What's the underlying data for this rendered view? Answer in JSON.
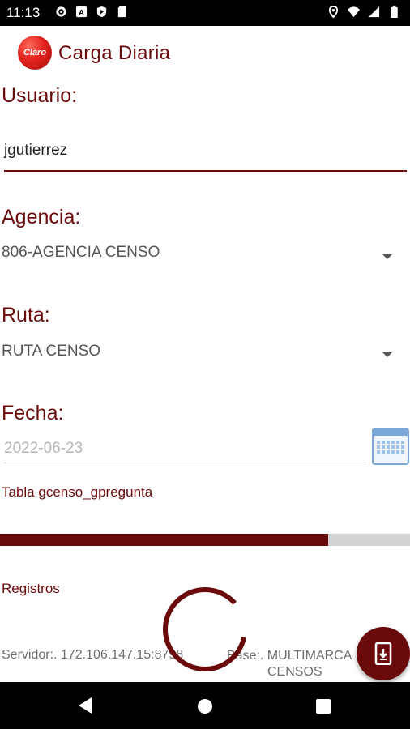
{
  "status_bar": {
    "time": "11:13",
    "left_icons": [
      "gear-icon",
      "a-icon",
      "play-shield-icon",
      "sd-card-icon"
    ],
    "right_icons": [
      "location-icon",
      "wifi-icon",
      "signal-icon",
      "battery-icon"
    ]
  },
  "app_bar": {
    "logo_text": "Claro",
    "title": "Carga Diaria"
  },
  "form": {
    "usuario_label": "Usuario:",
    "usuario_value": "jgutierrez",
    "agencia_label": "Agencia:",
    "agencia_value": "806-AGENCIA CENSO",
    "ruta_label": "Ruta:",
    "ruta_value": "RUTA CENSO",
    "fecha_label": "Fecha:",
    "fecha_value": "2022-06-23"
  },
  "progress": {
    "table_label": "Tabla gcenso_gpregunta",
    "fraction": 0.8
  },
  "registros_label": "Registros",
  "footer": {
    "servidor": "Servidor:. 172.106.147.15:8798",
    "base_line1": "Base:. MULTIMARCA",
    "base_line2": "CENSOS"
  },
  "colors": {
    "accent": "#6b0a0a",
    "progress_track": "#d3d3d3"
  }
}
